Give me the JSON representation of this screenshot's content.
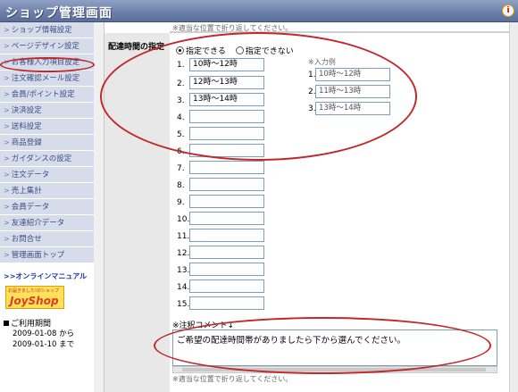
{
  "header": {
    "title": "ショップ管理画面",
    "icon": "info-icon"
  },
  "sidebar": {
    "items": [
      {
        "label": "ショップ情報設定"
      },
      {
        "label": "ページデザイン設定"
      },
      {
        "label": "お客様入力項目設定"
      },
      {
        "label": "注文確認メール設定"
      },
      {
        "label": "会員/ポイント設定"
      },
      {
        "label": "決済設定"
      },
      {
        "label": "送料設定"
      },
      {
        "label": "商品登録"
      },
      {
        "label": "ガイダンスの設定"
      },
      {
        "label": "注文データ"
      },
      {
        "label": "売上集計"
      },
      {
        "label": "会員データ"
      },
      {
        "label": "友達紹介データ"
      },
      {
        "label": "お問合せ"
      },
      {
        "label": "管理画面トップ"
      }
    ],
    "arrow": ">",
    "manual_link": ">>オンラインマニュアル",
    "logo": {
      "small": "お届きました!のショップ",
      "main": "JoyShop"
    },
    "period": {
      "title": "ご利用期間",
      "start": "2009-01-08 から",
      "end": "2009-01-10 まで"
    }
  },
  "main": {
    "top_note": "※適当な位置で折り返してください。",
    "field_label": "配達時間の指定",
    "radio": {
      "option_yes": "指定できる",
      "option_no": "指定できない",
      "selected": "指定できる"
    },
    "slots": [
      {
        "num": "1.",
        "value": "10時～12時"
      },
      {
        "num": "2.",
        "value": "12時～13時"
      },
      {
        "num": "3.",
        "value": "13時～14時"
      },
      {
        "num": "4.",
        "value": ""
      },
      {
        "num": "5.",
        "value": ""
      },
      {
        "num": "6.",
        "value": ""
      },
      {
        "num": "7.",
        "value": ""
      },
      {
        "num": "8.",
        "value": ""
      },
      {
        "num": "9.",
        "value": ""
      },
      {
        "num": "10.",
        "value": ""
      },
      {
        "num": "11.",
        "value": ""
      },
      {
        "num": "12.",
        "value": ""
      },
      {
        "num": "13.",
        "value": ""
      },
      {
        "num": "14.",
        "value": ""
      },
      {
        "num": "15.",
        "value": ""
      }
    ],
    "example": {
      "title": "※入力例",
      "items": [
        {
          "num": "1.",
          "value": "10時～12時"
        },
        {
          "num": "2.",
          "value": "11時～13時"
        },
        {
          "num": "3.",
          "value": "13時～14時"
        }
      ]
    },
    "comment_label": "※注釈コメント↓",
    "comment_value": "ご希望の配達時間帯がありましたら下から選んでください。",
    "bottom_note": "※適当な位置で折り返してください。"
  },
  "colors": {
    "header": "#6b7ea9",
    "nav_bg": "#d7dceb",
    "nav_text": "#3b4d86",
    "annotation": "#c0282c"
  }
}
